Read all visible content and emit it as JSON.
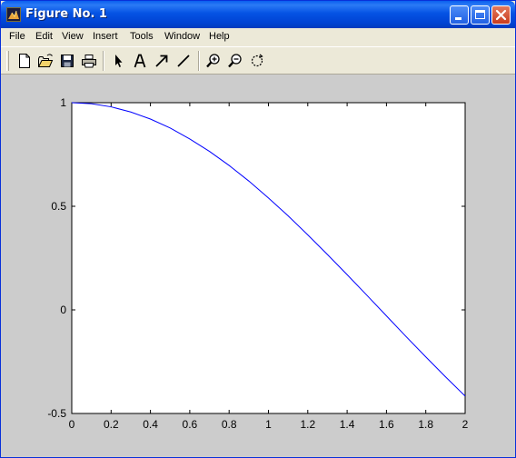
{
  "window": {
    "title": "Figure No. 1"
  },
  "menu": {
    "items": [
      "File",
      "Edit",
      "View",
      "Insert",
      "Tools",
      "Window",
      "Help"
    ]
  },
  "toolbar": {
    "icons": [
      "new-figure-icon",
      "open-file-icon",
      "save-icon",
      "print-icon",
      "select-arrow-icon",
      "insert-text-icon",
      "insert-arrow-icon",
      "insert-line-icon",
      "zoom-in-icon",
      "zoom-out-icon",
      "rotate-3d-icon"
    ]
  },
  "colors": {
    "figure_background": "#cccccc",
    "axes_background": "#ffffff",
    "line": "#0000ff"
  },
  "chart_data": {
    "type": "line",
    "title": "",
    "xlabel": "",
    "ylabel": "",
    "xlim": [
      0,
      2
    ],
    "ylim": [
      -0.5,
      1
    ],
    "xticks": [
      "0",
      "0.2",
      "0.4",
      "0.6",
      "0.8",
      "1",
      "1.2",
      "1.4",
      "1.6",
      "1.8",
      "2"
    ],
    "yticks": [
      "-0.5",
      "0",
      "0.5",
      "1"
    ],
    "xtick_values": [
      0,
      0.2,
      0.4,
      0.6,
      0.8,
      1,
      1.2,
      1.4,
      1.6,
      1.8,
      2
    ],
    "ytick_values": [
      -0.5,
      0,
      0.5,
      1
    ],
    "grid": false,
    "series": [
      {
        "x": [
          0,
          0.1,
          0.2,
          0.3,
          0.4,
          0.5,
          0.6,
          0.7,
          0.8,
          0.9,
          1.0,
          1.1,
          1.2,
          1.3,
          1.4,
          1.5,
          1.6,
          1.7,
          1.8,
          1.9,
          2.0
        ],
        "y": [
          1.0,
          0.995,
          0.98,
          0.955,
          0.921,
          0.878,
          0.825,
          0.765,
          0.697,
          0.622,
          0.54,
          0.454,
          0.362,
          0.267,
          0.17,
          0.071,
          -0.029,
          -0.129,
          -0.227,
          -0.323,
          -0.416
        ],
        "color": "#0000ff"
      }
    ]
  }
}
